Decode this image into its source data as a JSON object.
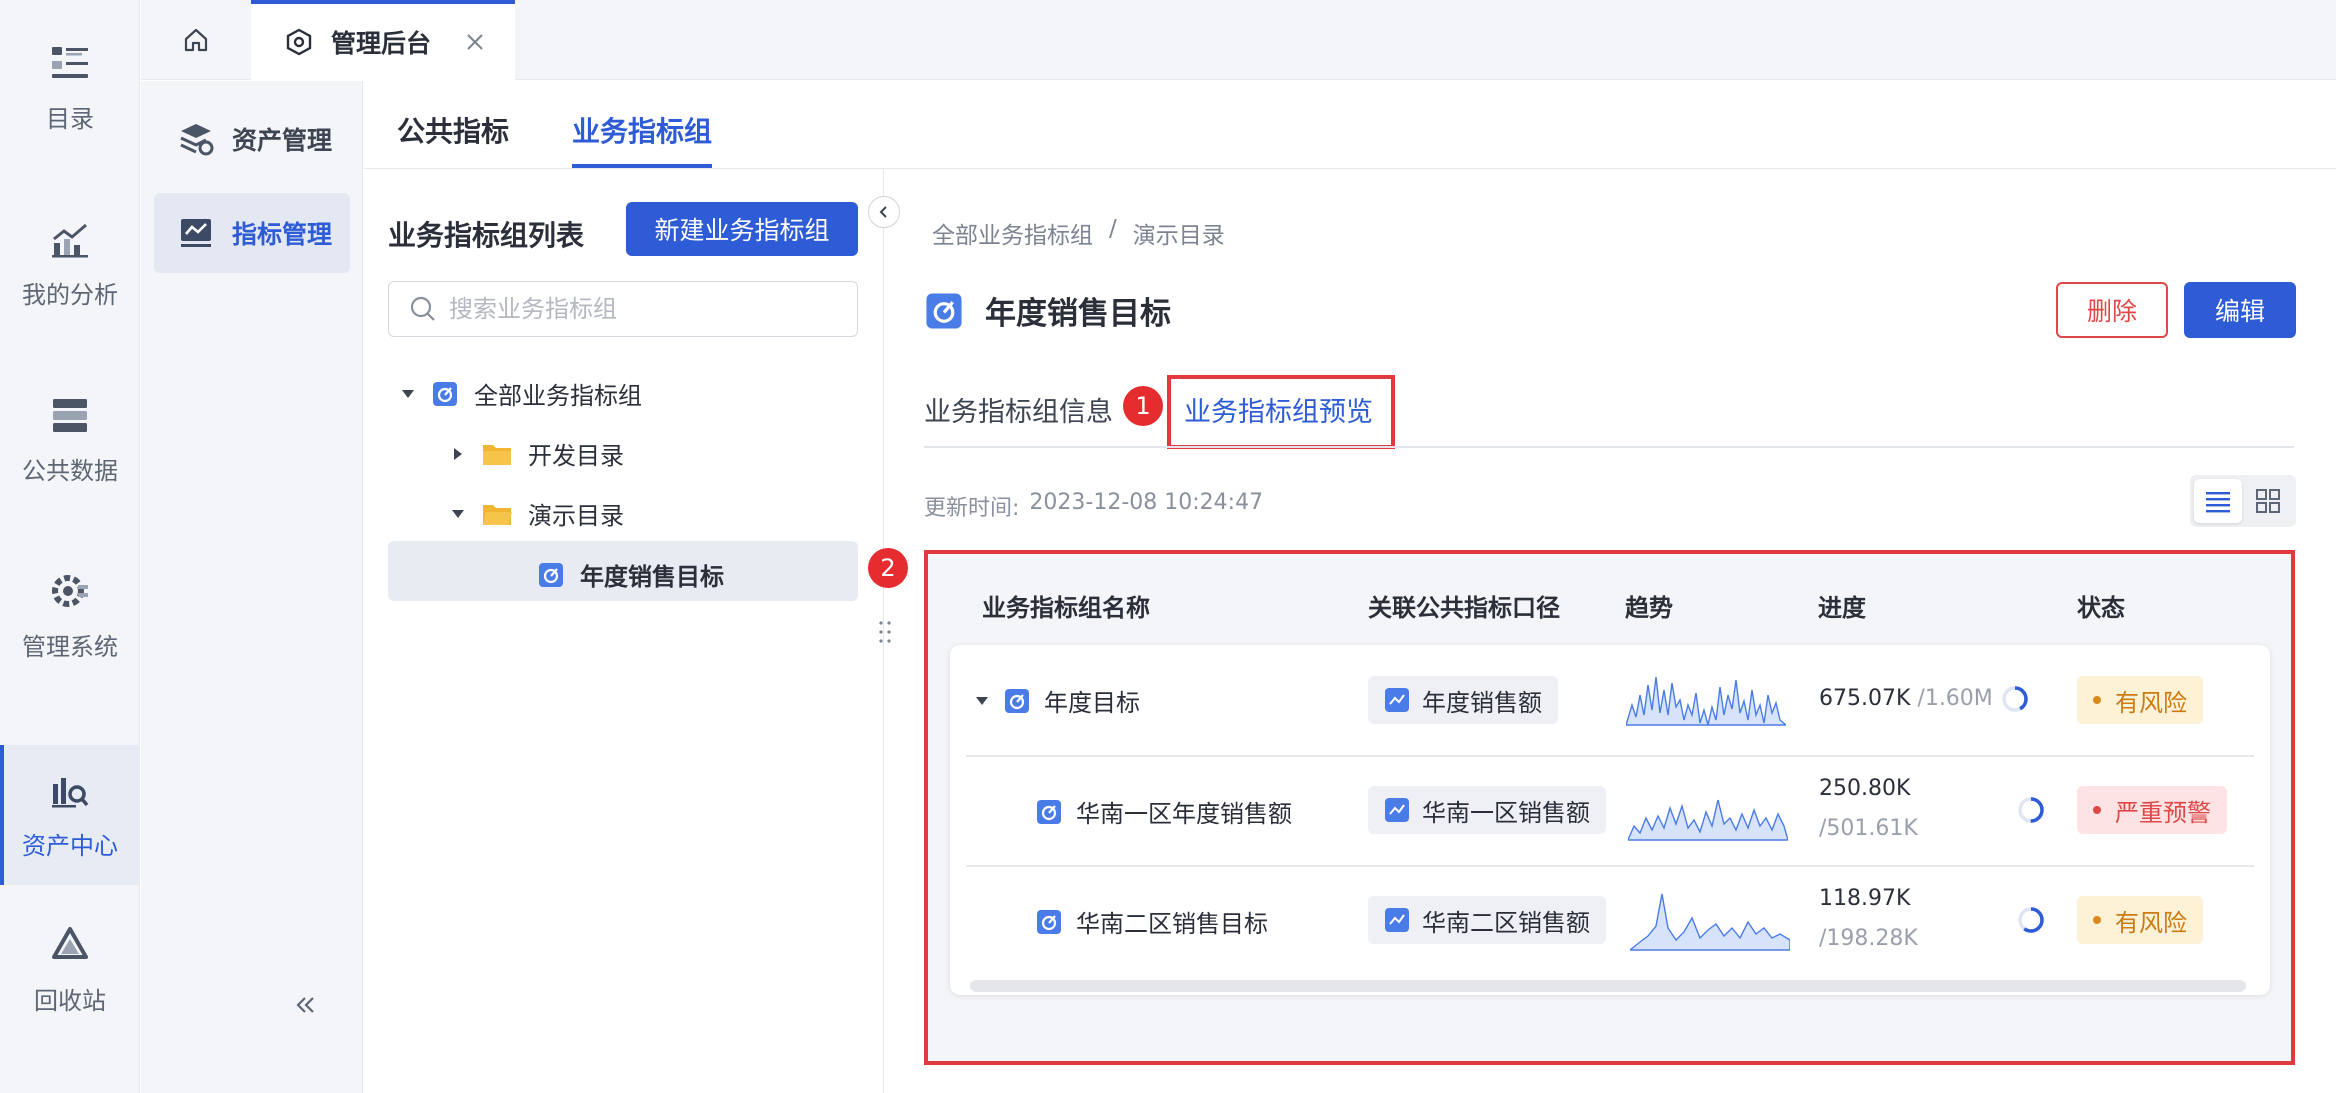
{
  "rail": {
    "items": [
      {
        "label": "目录",
        "icon": "catalog-icon"
      },
      {
        "label": "我的分析",
        "icon": "analysis-icon"
      },
      {
        "label": "公共数据",
        "icon": "database-icon"
      },
      {
        "label": "管理系统",
        "icon": "gear-icon"
      },
      {
        "label": "资产中心",
        "icon": "asset-search-icon"
      },
      {
        "label": "回收站",
        "icon": "recycle-icon"
      }
    ]
  },
  "tabs": {
    "home_icon": "home-icon",
    "admin_label": "管理后台"
  },
  "sidebar2": {
    "items": [
      {
        "label": "资产管理",
        "icon": "asset-stack-icon"
      },
      {
        "label": "指标管理",
        "icon": "metric-chart-icon"
      }
    ]
  },
  "content_tabs": [
    "公共指标",
    "业务指标组"
  ],
  "list_panel": {
    "title": "业务指标组列表",
    "new_button": "新建业务指标组",
    "search_placeholder": "搜索业务指标组",
    "tree": [
      {
        "label": "全部业务指标组"
      },
      {
        "label": "开发目录"
      },
      {
        "label": "演示目录"
      },
      {
        "label": "年度销售目标"
      }
    ]
  },
  "detail": {
    "breadcrumb": [
      "全部业务指标组",
      "/",
      "演示目录"
    ],
    "title": "年度销售目标",
    "delete_button": "删除",
    "edit_button": "编辑",
    "subtabs": [
      "业务指标组信息",
      "业务指标组预览"
    ],
    "annotations": [
      "1",
      "2"
    ],
    "update_label": "更新时间:",
    "update_time": "2023-12-08 10:24:47"
  },
  "table": {
    "headers": [
      "业务指标组名称",
      "关联公共指标口径",
      "趋势",
      "进度",
      "状态"
    ],
    "rows": [
      {
        "name": "年度目标",
        "metric": "年度销售额",
        "progress_value": "675.07K",
        "progress_total": "/1.60M",
        "progress_ratio": 0.42,
        "status": "有风险",
        "status_color": "#cc7a12"
      },
      {
        "name": "华南一区年度销售额",
        "metric": "华南一区销售额",
        "progress_value": "250.80K",
        "progress_total": "/501.61K",
        "progress_ratio": 0.5,
        "status": "严重预警",
        "status_color": "#e04848"
      },
      {
        "name": "华南二区销售目标",
        "metric": "华南二区销售额",
        "progress_value": "118.97K",
        "progress_total": "/198.28K",
        "progress_ratio": 0.6,
        "status": "有风险",
        "status_color": "#cc7a12"
      }
    ]
  },
  "colors": {
    "accent": "#2e5bd6",
    "danger": "#e04848",
    "annotation": "#e0393e"
  }
}
